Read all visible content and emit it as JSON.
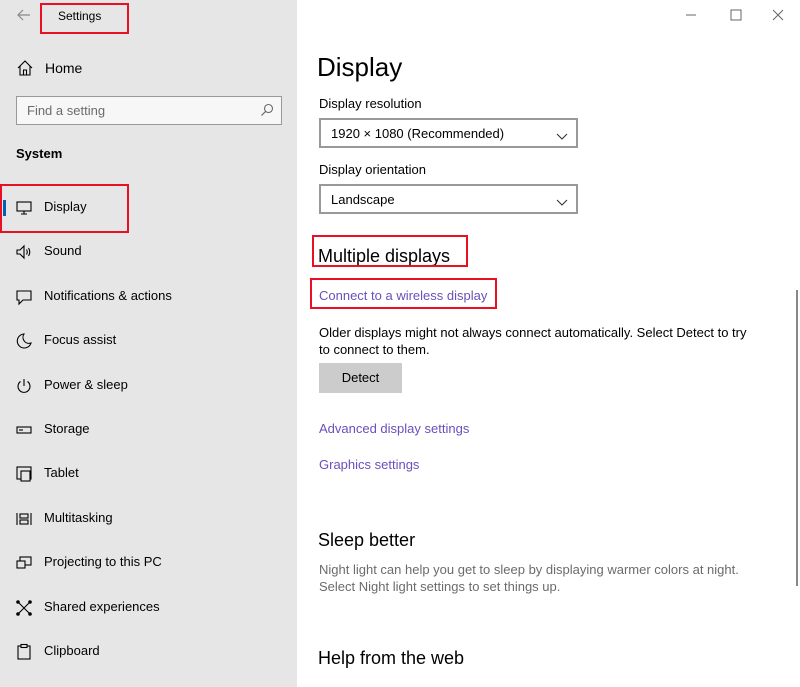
{
  "app": {
    "title": "Settings"
  },
  "sidebar": {
    "home_label": "Home",
    "search_placeholder": "Find a setting",
    "section_label": "System",
    "items": [
      {
        "label": "Display",
        "icon": "monitor-icon",
        "selected": true
      },
      {
        "label": "Sound",
        "icon": "speaker-icon"
      },
      {
        "label": "Notifications & actions",
        "icon": "notification-icon"
      },
      {
        "label": "Focus assist",
        "icon": "moon-icon"
      },
      {
        "label": "Power & sleep",
        "icon": "power-icon"
      },
      {
        "label": "Storage",
        "icon": "storage-icon"
      },
      {
        "label": "Tablet",
        "icon": "tablet-icon"
      },
      {
        "label": "Multitasking",
        "icon": "multitasking-icon"
      },
      {
        "label": "Projecting to this PC",
        "icon": "projecting-icon"
      },
      {
        "label": "Shared experiences",
        "icon": "shared-experiences-icon"
      },
      {
        "label": "Clipboard",
        "icon": "clipboard-icon"
      }
    ]
  },
  "main": {
    "title": "Display",
    "resolution_label": "Display resolution",
    "resolution_value": "1920 × 1080 (Recommended)",
    "orientation_label": "Display orientation",
    "orientation_value": "Landscape",
    "multiple_displays_heading": "Multiple displays",
    "wireless_link": "Connect to a wireless display",
    "older_displays_text": "Older displays might not always connect automatically. Select Detect to try to connect to them.",
    "detect_button": "Detect",
    "advanced_link": "Advanced display settings",
    "graphics_link": "Graphics settings",
    "sleep_heading": "Sleep better",
    "sleep_text": "Night light can help you get to sleep by displaying warmer colors at night. Select Night light settings to set things up.",
    "help_heading": "Help from the web"
  },
  "colors": {
    "accent": "#0063b1",
    "link": "#6b4fbb",
    "highlight": "#e81123",
    "sidebar_bg": "#e6e6e6"
  }
}
